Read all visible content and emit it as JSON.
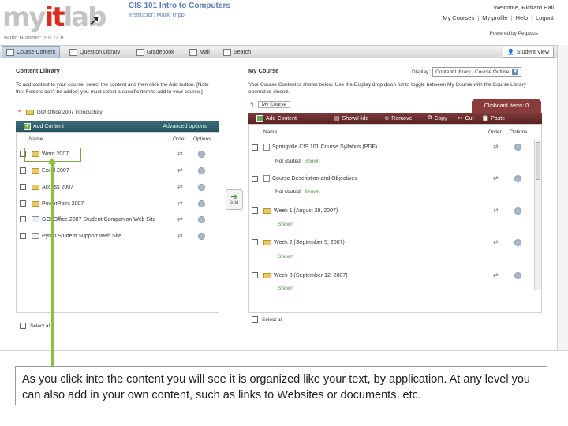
{
  "header": {
    "logo_text_1": "my",
    "logo_text_accent": "it",
    "logo_text_2": "lab",
    "course_title": "CIS 101 Intro to Computers",
    "instructor": "Instructor: Mark Tripp",
    "build": "Build Number: 2.0.72.0",
    "welcome": "Welcome, Richard Hall",
    "links": [
      "My Courses",
      "My profile",
      "Help",
      "Logout"
    ],
    "powered_by": "Powered by Pegasus"
  },
  "toolbar": {
    "items": [
      {
        "label": "Course Content",
        "active": true
      },
      {
        "label": "Question Library",
        "active": false
      },
      {
        "label": "Gradebook",
        "active": false
      },
      {
        "label": "Mail",
        "active": false
      },
      {
        "label": "Search",
        "active": false
      }
    ],
    "student_view": "Student View"
  },
  "library": {
    "title": "Content Library",
    "description": "To add content to your course, select the content and then click the Add button. [Note the: Folders can't be added; you must select a specific item to add to your course.]",
    "breadcrumb": "GO! Office 2007 Introductory",
    "add_content": "Add Content",
    "advanced_options": "Advanced options",
    "col_name": "Name",
    "col_order": "Order",
    "col_options": "Options",
    "items": [
      {
        "label": "Word 2007",
        "type": "folder"
      },
      {
        "label": "Excel 2007",
        "type": "folder"
      },
      {
        "label": "Access 2007",
        "type": "folder"
      },
      {
        "label": "PowerPoint 2007",
        "type": "folder"
      },
      {
        "label": "GO! Office 2007 Student Companion Web Site",
        "type": "web"
      },
      {
        "label": "Pyrah Student Support Web Site",
        "type": "web"
      }
    ],
    "select_all": "Select all"
  },
  "add_button": "Add",
  "course": {
    "title": "My Course",
    "display_label": "Display:",
    "display_value": "Content Library / Course Outline",
    "description": "Your Course Content is shown below. Use the Display drop down list to toggle between My Course with the Course Library opened or closed.",
    "breadcrumb": "My Course",
    "clipboard": "Clipboard items: 0",
    "add_content": "Add Content",
    "show_hide": "Show/Hide",
    "remove": "Remove",
    "copy": "Copy",
    "cut": "Cut",
    "paste": "Paste",
    "col_name": "Name",
    "col_order": "Order",
    "col_options": "Options",
    "items": [
      {
        "label": "Springville CIS 101 Course Syllabus (PDF)",
        "type": "doc",
        "status": "Not started",
        "shown": "Shown"
      },
      {
        "label": "Course Description and Objectives",
        "type": "doc",
        "status": "Not started",
        "shown": "Shown"
      },
      {
        "label": "Week 1 (August 29, 2007)",
        "type": "folder",
        "shown": "Shown"
      },
      {
        "label": "Week 2 (September 5, 2007)",
        "type": "folder",
        "shown": "Shown"
      },
      {
        "label": "Week 3 (September 12, 2007)",
        "type": "folder",
        "shown": "Shown"
      }
    ],
    "select_all": "Select all"
  },
  "caption": "As you click into the content you will see it is organized like your text, by application. At any level you can also add in your own content, such as links to Websites or documents, etc."
}
